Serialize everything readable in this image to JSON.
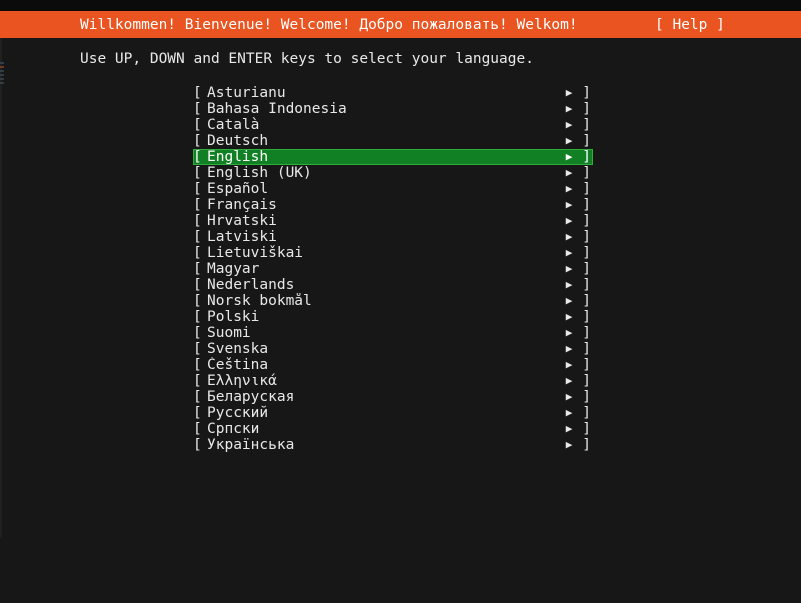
{
  "theme": {
    "background": "#171717",
    "accent_orange": "#e95420",
    "highlight_green": "#118024",
    "text": "#e8e8e8",
    "letterbox": "#000000"
  },
  "header": {
    "title": "Willkommen! Bienvenue! Welcome! Добро пожаловать! Welkom!",
    "help_label": "[ Help ]"
  },
  "instruction": "Use UP, DOWN and ENTER keys to select your language.",
  "list": {
    "bracket_open": "[",
    "bracket_close": "]",
    "arrow_icon": "▶",
    "selected_index": 4,
    "items": [
      {
        "label": "Asturianu"
      },
      {
        "label": "Bahasa Indonesia"
      },
      {
        "label": "Català"
      },
      {
        "label": "Deutsch"
      },
      {
        "label": "English"
      },
      {
        "label": "English (UK)"
      },
      {
        "label": "Español"
      },
      {
        "label": "Français"
      },
      {
        "label": "Hrvatski"
      },
      {
        "label": "Latviski"
      },
      {
        "label": "Lietuviškai"
      },
      {
        "label": "Magyar"
      },
      {
        "label": "Nederlands"
      },
      {
        "label": "Norsk bokmål"
      },
      {
        "label": "Polski"
      },
      {
        "label": "Suomi"
      },
      {
        "label": "Svenska"
      },
      {
        "label": "Čeština"
      },
      {
        "label": "Ελληνικά"
      },
      {
        "label": "Беларуская"
      },
      {
        "label": "Русский"
      },
      {
        "label": "Српски"
      },
      {
        "label": "Українська"
      }
    ]
  }
}
